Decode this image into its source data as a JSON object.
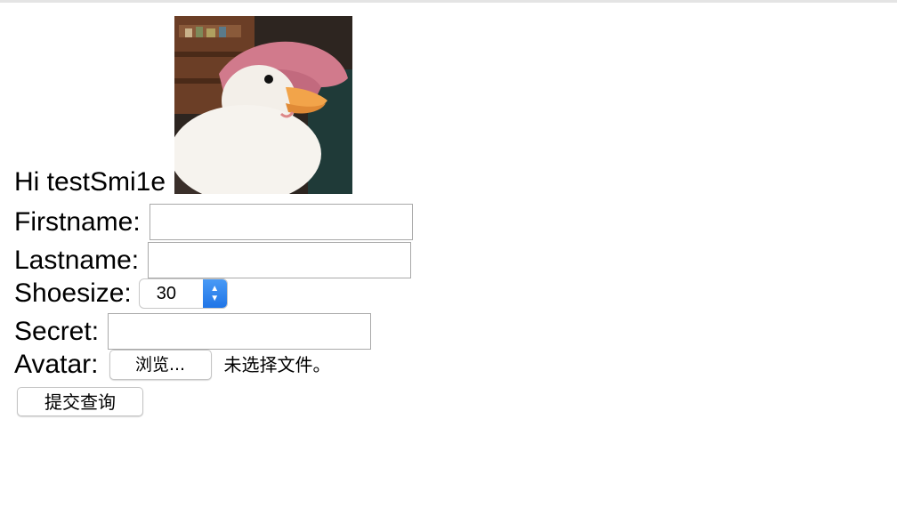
{
  "greeting": "Hi testSmi1e",
  "avatar_image": {
    "icon": "duck-photo"
  },
  "form": {
    "firstname_label": "Firstname:",
    "firstname_value": "",
    "lastname_label": "Lastname:",
    "lastname_value": "",
    "shoesize_label": "Shoesize:",
    "shoesize_value": "30",
    "secret_label": "Secret:",
    "secret_value": "",
    "avatar_label": "Avatar:",
    "file_button_label": "浏览...",
    "file_status": "未选择文件。",
    "submit_label": "提交查询"
  },
  "colors": {
    "select_accent": "#1f74e6"
  }
}
